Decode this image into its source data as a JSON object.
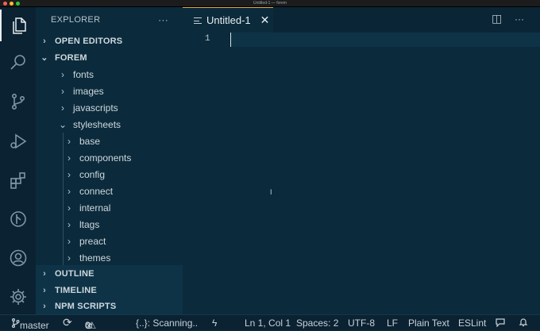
{
  "window": {
    "title": "Untitled-1 — forem"
  },
  "activity_bar": [
    {
      "name": "explorer-icon"
    },
    {
      "name": "search-icon"
    },
    {
      "name": "source-control-icon"
    },
    {
      "name": "run-debug-icon"
    },
    {
      "name": "extensions-icon"
    },
    {
      "name": "git-graph-icon"
    },
    {
      "name": "account-icon"
    },
    {
      "name": "settings-gear-icon"
    }
  ],
  "sidebar": {
    "title": "EXPLORER",
    "more": "···",
    "sections": {
      "open_editors": "OPEN EDITORS",
      "project": "FOREM",
      "outline": "OUTLINE",
      "timeline": "TIMELINE",
      "npm": "NPM SCRIPTS"
    },
    "tree": {
      "fonts": "fonts",
      "images": "images",
      "javascripts": "javascripts",
      "stylesheets": "stylesheets",
      "children": [
        "base",
        "components",
        "config",
        "connect",
        "internal",
        "ltags",
        "preact",
        "themes"
      ]
    }
  },
  "editor": {
    "tab_label": "Untitled-1",
    "tab_close": "✕",
    "line_number": "1",
    "cursor_glyph": "I",
    "split_icon_glyph": "◫",
    "more_glyph": "···"
  },
  "status_bar": {
    "branch": "master",
    "sync_glyph": "⟳",
    "errors": "0",
    "warnings": "0",
    "scanning": "{..}: Scanning..",
    "bolt_glyph": "ϟ",
    "position": "Ln 1, Col 1",
    "spaces": "Spaces: 2",
    "encoding": "UTF-8",
    "eol": "LF",
    "language": "Plain Text",
    "linter": "ESLint"
  },
  "colors": {
    "accent_tab_border": "#e0a93b",
    "background": "#0b2b3c"
  }
}
